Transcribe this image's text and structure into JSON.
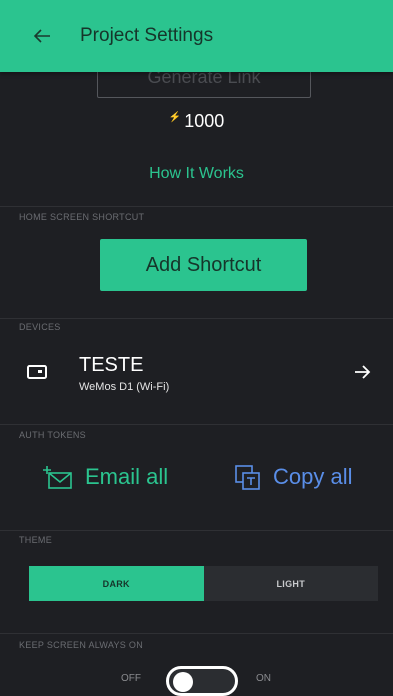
{
  "header": {
    "title": "Project Settings",
    "back_icon": "arrow-left-icon"
  },
  "share": {
    "generate_link_label": "Generate Link"
  },
  "energy": {
    "symbol": "⚡",
    "value": "1000"
  },
  "how_it_works": "How It Works",
  "home_shortcut": {
    "section": "HOME SCREEN SHORTCUT",
    "button": "Add Shortcut"
  },
  "devices": {
    "section": "DEVICES",
    "items": [
      {
        "name": "TESTE",
        "model": "WeMos D1 (Wi-Fi)"
      }
    ]
  },
  "auth_tokens": {
    "section": "AUTH TOKENS",
    "email_all": "Email all",
    "copy_all": "Copy all"
  },
  "theme": {
    "section": "THEME",
    "options": [
      "DARK",
      "LIGHT"
    ],
    "selected": "DARK"
  },
  "keep_screen": {
    "section": "KEEP SCREEN ALWAYS ON",
    "off_label": "OFF",
    "on_label": "ON",
    "enabled": false
  },
  "colors": {
    "accent": "#2bc48f",
    "background": "#1e1f23",
    "copy_blue": "#5a8ee8"
  }
}
